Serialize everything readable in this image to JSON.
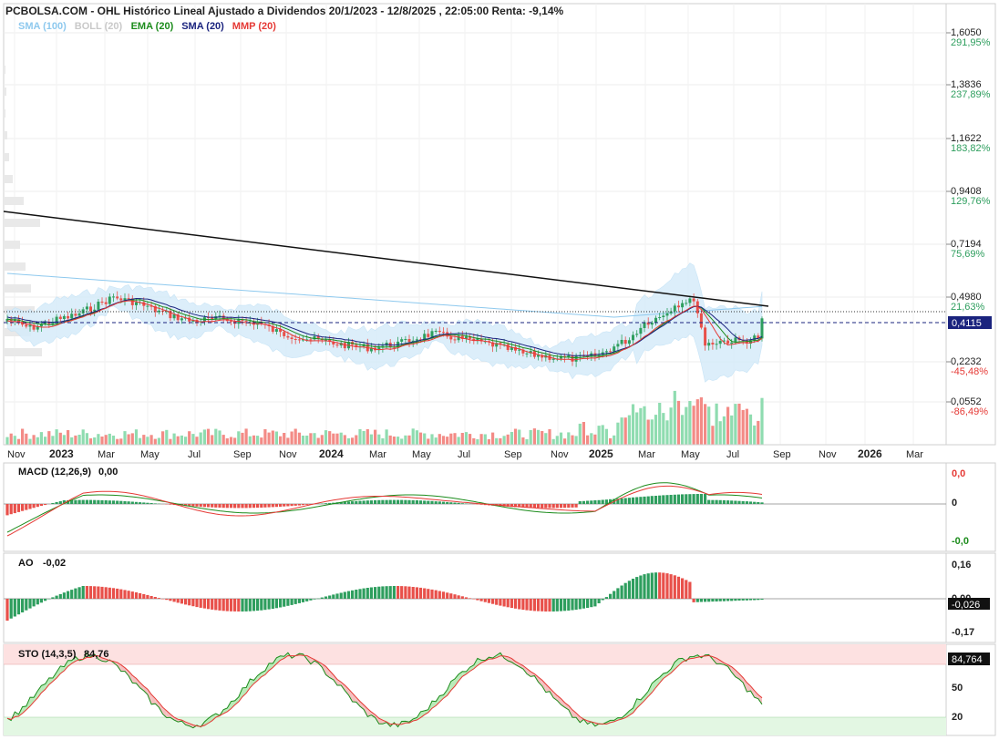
{
  "header": {
    "title": "PCBOLSA.COM - OHL Histórico Lineal Ajustado a Dividendos 20/1/2023 - 12/8/2025 , 22:05:00 Renta: -9,14%",
    "legend": [
      {
        "label": "SMA (100)",
        "color": "#8ec9ee"
      },
      {
        "label": "BOLL (20)",
        "color": "#c9c9c9"
      },
      {
        "label": "EMA (20)",
        "color": "#1c8c1c"
      },
      {
        "label": "SMA (20)",
        "color": "#1a237e"
      },
      {
        "label": "MMP (20)",
        "color": "#e53935"
      }
    ]
  },
  "colors": {
    "up": "#2e9e5e",
    "down": "#e8504a",
    "vol_up": "#8fdcb0",
    "vol_down": "#f38b86",
    "boll_fill": "#d6ecfa",
    "pct_up": "#2e9e5e",
    "pct_down": "#e53935"
  },
  "price_axis": {
    "levels": [
      {
        "value": "1,6050",
        "pct": "291,95%",
        "dir": "up"
      },
      {
        "value": "1,3836",
        "pct": "237,89%",
        "dir": "up"
      },
      {
        "value": "1,1622",
        "pct": "183,82%",
        "dir": "up"
      },
      {
        "value": "0,9408",
        "pct": "129,76%",
        "dir": "up"
      },
      {
        "value": "0,7194",
        "pct": "75,69%",
        "dir": "up"
      },
      {
        "value": "0,4980",
        "pct": "21,63%",
        "dir": "up"
      },
      {
        "value": "0,2232",
        "pct": "-45,48%",
        "dir": "down"
      },
      {
        "value": "0,0552",
        "pct": "-86,49%",
        "dir": "down"
      }
    ],
    "last_price": "0,4115"
  },
  "time_axis": {
    "labels": [
      {
        "text": "Nov",
        "bold": false
      },
      {
        "text": "2023",
        "bold": true
      },
      {
        "text": "Mar",
        "bold": false
      },
      {
        "text": "May",
        "bold": false
      },
      {
        "text": "Jul",
        "bold": false
      },
      {
        "text": "Sep",
        "bold": false
      },
      {
        "text": "Nov",
        "bold": false
      },
      {
        "text": "2024",
        "bold": true
      },
      {
        "text": "Mar",
        "bold": false
      },
      {
        "text": "May",
        "bold": false
      },
      {
        "text": "Jul",
        "bold": false
      },
      {
        "text": "Sep",
        "bold": false
      },
      {
        "text": "Nov",
        "bold": false
      },
      {
        "text": "2025",
        "bold": true
      },
      {
        "text": "Mar",
        "bold": false
      },
      {
        "text": "May",
        "bold": false
      },
      {
        "text": "Jul",
        "bold": false
      },
      {
        "text": "Sep",
        "bold": false
      },
      {
        "text": "Nov",
        "bold": false
      },
      {
        "text": "2026",
        "bold": true
      },
      {
        "text": "Mar",
        "bold": false
      }
    ]
  },
  "macd": {
    "label": "MACD (12,26,9)",
    "value": "0,00",
    "axis": [
      {
        "text": "0,0",
        "color": "#e53935"
      },
      {
        "text": "0",
        "color": "#222"
      },
      {
        "text": "-0,0",
        "color": "#1c8c1c"
      }
    ]
  },
  "ao": {
    "label": "AO",
    "value": "-0,02",
    "axis": [
      {
        "text": "0,16",
        "color": "#222"
      },
      {
        "text": "0,00",
        "color": "#222"
      },
      {
        "text": "-0,17",
        "color": "#222"
      }
    ],
    "last": "-0,026"
  },
  "sto": {
    "label": "STO (14,3,5)",
    "value": "84,76",
    "axis": [
      {
        "text": "80",
        "color": "#222"
      },
      {
        "text": "50",
        "color": "#222"
      },
      {
        "text": "20",
        "color": "#222"
      }
    ],
    "last": "84,764"
  },
  "chart_data": {
    "type": "candlestick",
    "x_range": [
      "20/1/2023",
      "12/8/2025"
    ],
    "y_range": [
      0.0552,
      1.605
    ],
    "y_log": false,
    "last_close": 0.4115,
    "trendline": [
      {
        "date": "2022-10",
        "value": 0.86
      },
      {
        "date": "2025-08",
        "value": 0.47
      }
    ],
    "approx_close": [
      0.38,
      0.4,
      0.43,
      0.45,
      0.44,
      0.43,
      0.42,
      0.41,
      0.4,
      0.41,
      0.39,
      0.4,
      0.38,
      0.36,
      0.34,
      0.32,
      0.32,
      0.33,
      0.36,
      0.35,
      0.33,
      0.31,
      0.3,
      0.29,
      0.28,
      0.27,
      0.28,
      0.28,
      0.29,
      0.32,
      0.36,
      0.43,
      0.47,
      0.35,
      0.32,
      0.31,
      0.31,
      0.3,
      0.31,
      0.33,
      0.41
    ]
  }
}
